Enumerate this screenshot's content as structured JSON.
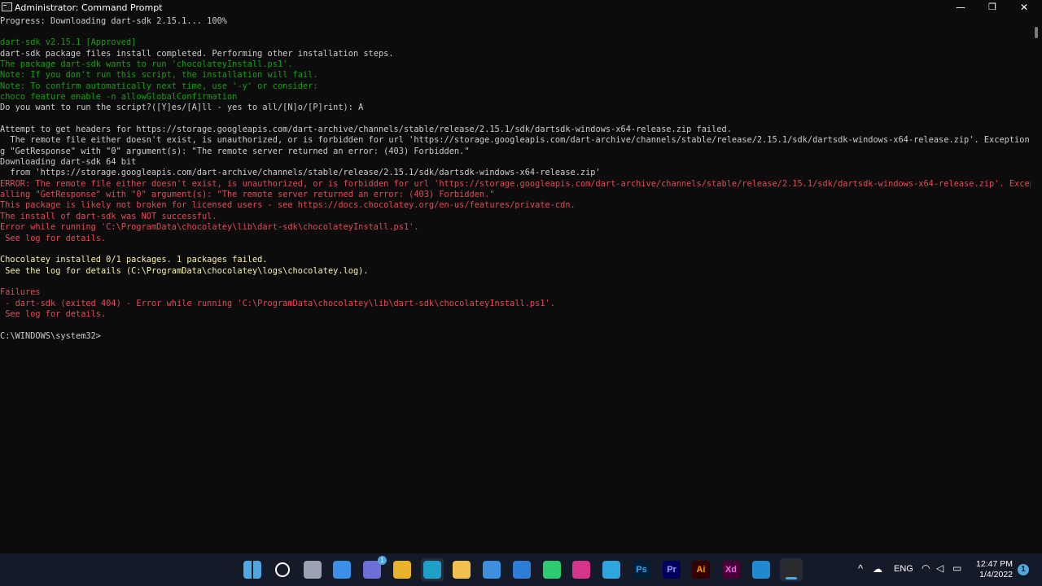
{
  "window": {
    "title": "Administrator: Command Prompt",
    "minimize_icon": "—",
    "maximize_icon": "❐",
    "close_icon": "✕"
  },
  "terminal": {
    "lines": [
      {
        "text": "Progress: Downloading dart-sdk 2.15.1... 100%",
        "color": "white"
      },
      {
        "text": "",
        "color": "white"
      },
      {
        "text": "dart-sdk v2.15.1 [Approved]",
        "color": "green"
      },
      {
        "text": "dart-sdk package files install completed. Performing other installation steps.",
        "color": "white"
      },
      {
        "text": "The package dart-sdk wants to run 'chocolateyInstall.ps1'.",
        "color": "green"
      },
      {
        "text": "Note: If you don't run this script, the installation will fail.",
        "color": "green"
      },
      {
        "text": "Note: To confirm automatically next time, use '-y' or consider:",
        "color": "green"
      },
      {
        "text": "choco feature enable -n allowGlobalConfirmation",
        "color": "green"
      },
      {
        "text": "Do you want to run the script?([Y]es/[A]ll - yes to all/[N]o/[P]rint): A",
        "color": "white"
      },
      {
        "text": "",
        "color": "white"
      },
      {
        "text": "Attempt to get headers for https://storage.googleapis.com/dart-archive/channels/stable/release/2.15.1/sdk/dartsdk-windows-x64-release.zip failed.",
        "color": "white"
      },
      {
        "text": "  The remote file either doesn't exist, is unauthorized, or is forbidden for url 'https://storage.googleapis.com/dart-archive/channels/stable/release/2.15.1/sdk/dartsdk-windows-x64-release.zip'. Exception callin",
        "color": "white"
      },
      {
        "text": "g \"GetResponse\" with \"0\" argument(s): \"The remote server returned an error: (403) Forbidden.\"",
        "color": "white"
      },
      {
        "text": "Downloading dart-sdk 64 bit",
        "color": "white"
      },
      {
        "text": "  from 'https://storage.googleapis.com/dart-archive/channels/stable/release/2.15.1/sdk/dartsdk-windows-x64-release.zip'",
        "color": "white"
      },
      {
        "text": "ERROR: The remote file either doesn't exist, is unauthorized, or is forbidden for url 'https://storage.googleapis.com/dart-archive/channels/stable/release/2.15.1/sdk/dartsdk-windows-x64-release.zip'. Exception c",
        "color": "red"
      },
      {
        "text": "alling \"GetResponse\" with \"0\" argument(s): \"The remote server returned an error: (403) Forbidden.\"",
        "color": "red"
      },
      {
        "text": "This package is likely not broken for licensed users - see https://docs.chocolatey.org/en-us/features/private-cdn.",
        "color": "red"
      },
      {
        "text": "The install of dart-sdk was NOT successful.",
        "color": "red"
      },
      {
        "text": "Error while running 'C:\\ProgramData\\chocolatey\\lib\\dart-sdk\\chocolateyInstall.ps1'.",
        "color": "red"
      },
      {
        "text": " See log for details.",
        "color": "red"
      },
      {
        "text": "",
        "color": "white"
      },
      {
        "text": "Chocolatey installed 0/1 packages. 1 packages failed.",
        "color": "yellow"
      },
      {
        "text": " See the log for details (C:\\ProgramData\\chocolatey\\logs\\chocolatey.log).",
        "color": "yellow"
      },
      {
        "text": "",
        "color": "white"
      },
      {
        "text": "Failures",
        "color": "red"
      },
      {
        "text": " - dart-sdk (exited 404) - Error while running 'C:\\ProgramData\\chocolatey\\lib\\dart-sdk\\chocolateyInstall.ps1'.",
        "color": "red"
      },
      {
        "text": " See log for details.",
        "color": "red"
      },
      {
        "text": "",
        "color": "white"
      },
      {
        "text": "C:\\WINDOWS\\system32>",
        "color": "white"
      }
    ]
  },
  "colors": {
    "white": "#cccccc",
    "green": "#13a10e",
    "yellow": "#f9f1a5",
    "red": "#e74856",
    "taskbar": "#141a28",
    "accent": "#4fa8e0"
  },
  "taskbar": {
    "apps": [
      {
        "name": "windows-start-icon",
        "glyph": "",
        "bg": "#4fa8e0",
        "fg": "#ffffff"
      },
      {
        "name": "search-icon",
        "glyph": "",
        "bg": "transparent",
        "fg": "#ffffff"
      },
      {
        "name": "task-view-icon",
        "glyph": "",
        "bg": "#9aa3b5",
        "fg": "#ffffff"
      },
      {
        "name": "widgets-icon",
        "glyph": "",
        "bg": "#3a8ee6",
        "fg": "#ffffff"
      },
      {
        "name": "teams-chat-icon",
        "glyph": "",
        "bg": "#6b6fd6",
        "fg": "#ffffff",
        "badge": "1"
      },
      {
        "name": "chrome-icon",
        "glyph": "",
        "bg": "#e8b32a",
        "fg": "#ffffff"
      },
      {
        "name": "edge-icon",
        "glyph": "",
        "bg": "#1fa0c9",
        "fg": "#ffffff",
        "active": true
      },
      {
        "name": "file-explorer-icon",
        "glyph": "",
        "bg": "#f1c14d",
        "fg": "#ffffff"
      },
      {
        "name": "microsoft-store-icon",
        "glyph": "",
        "bg": "#3d8fe0",
        "fg": "#ffffff"
      },
      {
        "name": "mail-icon",
        "glyph": "",
        "bg": "#2e7dd6",
        "fg": "#ffffff"
      },
      {
        "name": "whatsapp-icon",
        "glyph": "",
        "bg": "#2ecc71",
        "fg": "#ffffff"
      },
      {
        "name": "instagram-icon",
        "glyph": "",
        "bg": "#d6338a",
        "fg": "#ffffff"
      },
      {
        "name": "telegram-icon",
        "glyph": "",
        "bg": "#2ea5dd",
        "fg": "#ffffff"
      },
      {
        "name": "photoshop-icon",
        "glyph": "Ps",
        "bg": "#001e36",
        "fg": "#31a8ff"
      },
      {
        "name": "premiere-pro-icon",
        "glyph": "Pr",
        "bg": "#00005b",
        "fg": "#9999ff"
      },
      {
        "name": "illustrator-icon",
        "glyph": "Ai",
        "bg": "#330000",
        "fg": "#ff9a00"
      },
      {
        "name": "adobe-xd-icon",
        "glyph": "Xd",
        "bg": "#470137",
        "fg": "#ff61f6"
      },
      {
        "name": "vscode-icon",
        "glyph": "",
        "bg": "#1f8ad2",
        "fg": "#ffffff"
      },
      {
        "name": "terminal-icon",
        "glyph": "",
        "bg": "#2b2b2b",
        "fg": "#ffffff",
        "active": true,
        "running": true
      }
    ],
    "tray": {
      "chevron": "^",
      "language": "ENG",
      "time": "12:47 PM",
      "date": "1/4/2022",
      "notification_count": "1"
    }
  }
}
